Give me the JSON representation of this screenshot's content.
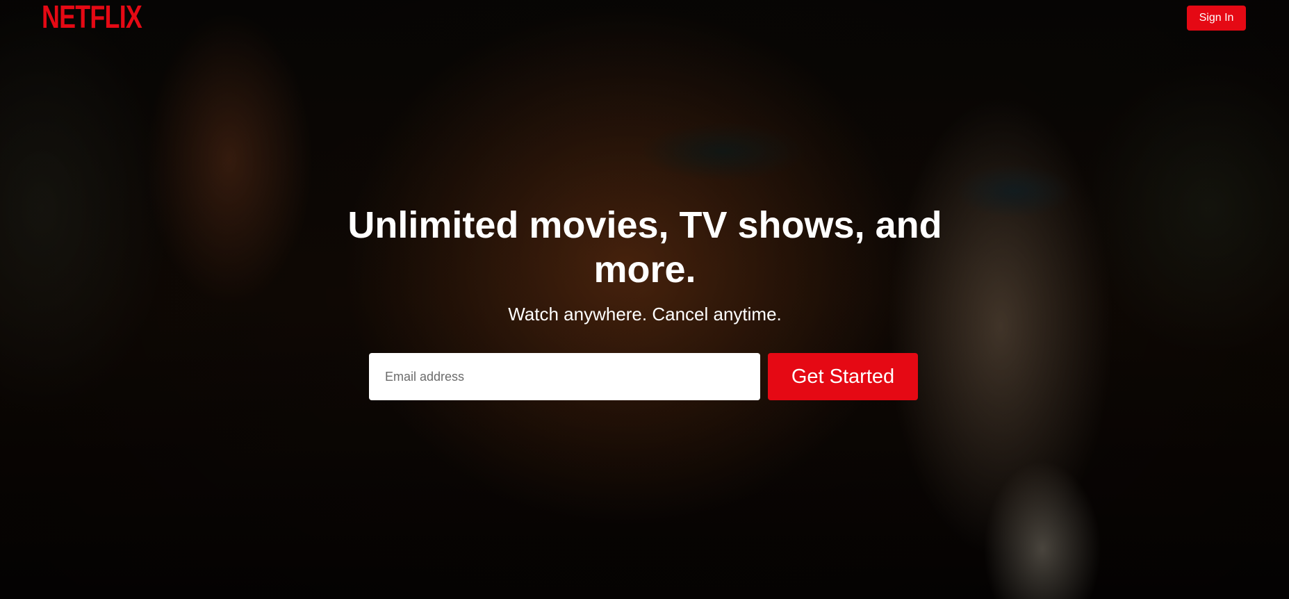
{
  "brand": {
    "logo_text": "NETFLIX",
    "accent_color": "#e50914"
  },
  "header": {
    "signin_label": "Sign In"
  },
  "hero": {
    "headline": "Unlimited movies, TV shows, and more.",
    "subheadline": "Watch anywhere. Cancel anytime."
  },
  "signup": {
    "email_placeholder": "Email address",
    "email_value": "",
    "cta_label": "Get Started"
  }
}
